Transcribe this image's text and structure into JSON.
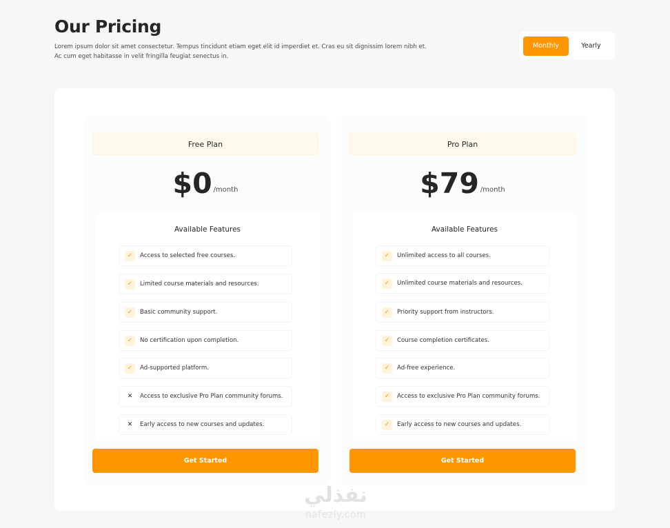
{
  "header": {
    "title": "Our Pricing",
    "description": "Lorem ipsum dolor sit amet consectetur. Tempus tincidunt etiam eget elit id imperdiet et. Cras eu sit dignissim lorem nibh et. Ac cum eget habitasse in velit fringilla feugiat senectus in."
  },
  "billing_toggle": {
    "options": [
      "Monthly",
      "Yearly"
    ],
    "selected": "Monthly"
  },
  "colors": {
    "accent": "#ff9500",
    "page_bg": "#f7f7f8",
    "plan_header_bg": "#fff9ed"
  },
  "plans": [
    {
      "name": "Free Plan",
      "price": "$0",
      "period": "/month",
      "features_title": "Available Features",
      "features": [
        {
          "label": "Access to selected free courses.",
          "included": true,
          "icon": "check-icon"
        },
        {
          "label": "Limited course materials and resources.",
          "included": true,
          "icon": "check-icon"
        },
        {
          "label": "Basic community support.",
          "included": true,
          "icon": "check-icon"
        },
        {
          "label": "No certification upon completion.",
          "included": true,
          "icon": "check-icon"
        },
        {
          "label": "Ad-supported platform.",
          "included": true,
          "icon": "check-icon"
        },
        {
          "label": "Access to exclusive Pro Plan community forums.",
          "included": false,
          "icon": "cross-icon"
        },
        {
          "label": "Early access to new courses and updates.",
          "included": false,
          "icon": "cross-icon"
        }
      ],
      "cta": "Get Started"
    },
    {
      "name": "Pro Plan",
      "price": "$79",
      "period": "/month",
      "features_title": "Available Features",
      "features": [
        {
          "label": "Unlimited access to all courses.",
          "included": true,
          "icon": "check-icon"
        },
        {
          "label": "Unlimited course materials and resources.",
          "included": true,
          "icon": "check-icon"
        },
        {
          "label": "Priority support from instructors.",
          "included": true,
          "icon": "check-icon"
        },
        {
          "label": "Course completion certificates.",
          "included": true,
          "icon": "check-icon"
        },
        {
          "label": "Ad-free experience.",
          "included": true,
          "icon": "check-icon"
        },
        {
          "label": "Access to exclusive Pro Plan community forums.",
          "included": true,
          "icon": "check-icon"
        },
        {
          "label": "Early access to new courses and updates.",
          "included": true,
          "icon": "check-icon"
        }
      ],
      "cta": "Get Started"
    }
  ],
  "watermark": {
    "logo": "نفذلي",
    "url": "nafezly.com"
  }
}
